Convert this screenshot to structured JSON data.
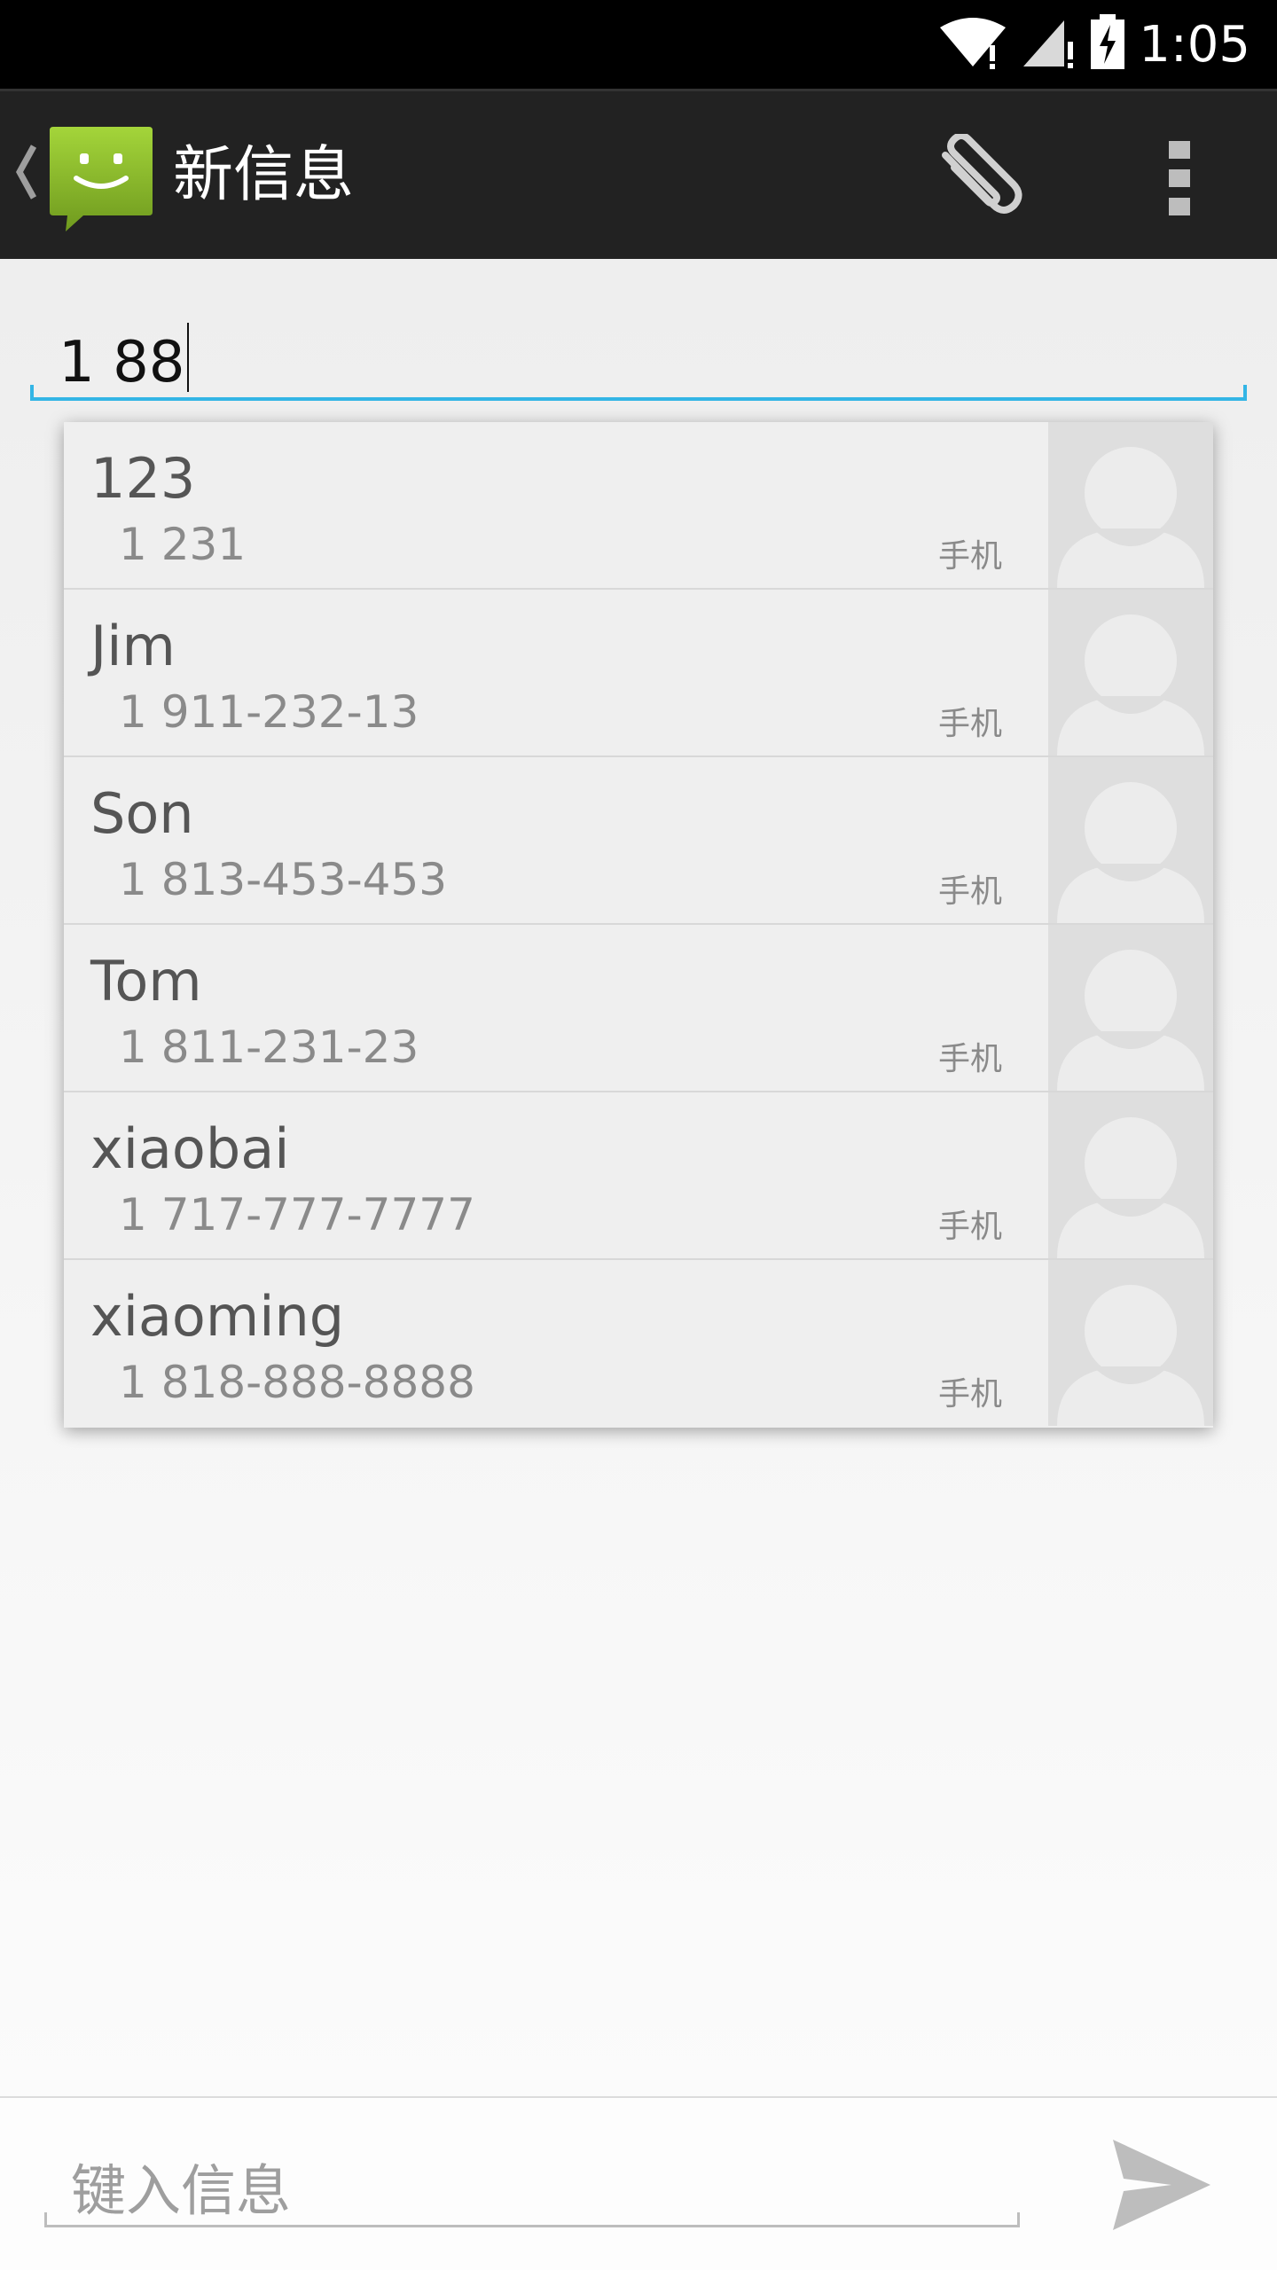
{
  "status_bar": {
    "time": "1:05",
    "icons": [
      "wifi-icon",
      "signal-icon",
      "battery-charging-icon"
    ]
  },
  "action_bar": {
    "title": "新信息",
    "app_icon": "messaging-app-icon",
    "actions": [
      "paperclip-icon",
      "overflow-menu-icon"
    ]
  },
  "recipient": {
    "value": "1 88"
  },
  "suggestions": [
    {
      "name": "123",
      "number": "1 231",
      "type": "手机"
    },
    {
      "name": "Jim",
      "number": "1 911-232-13",
      "type": "手机"
    },
    {
      "name": "Son",
      "number": "1 813-453-453",
      "type": "手机"
    },
    {
      "name": "Tom",
      "number": "1 811-231-23",
      "type": "手机"
    },
    {
      "name": "xiaobai",
      "number": "1 717-777-7777",
      "type": "手机"
    },
    {
      "name": "xiaoming",
      "number": "1 818-888-8888",
      "type": "手机"
    }
  ],
  "compose": {
    "placeholder": "键入信息",
    "send_icon": "send-icon"
  },
  "colors": {
    "accent": "#33b5e5",
    "app_icon_green": "#8bc34a",
    "action_bar": "#222222"
  }
}
